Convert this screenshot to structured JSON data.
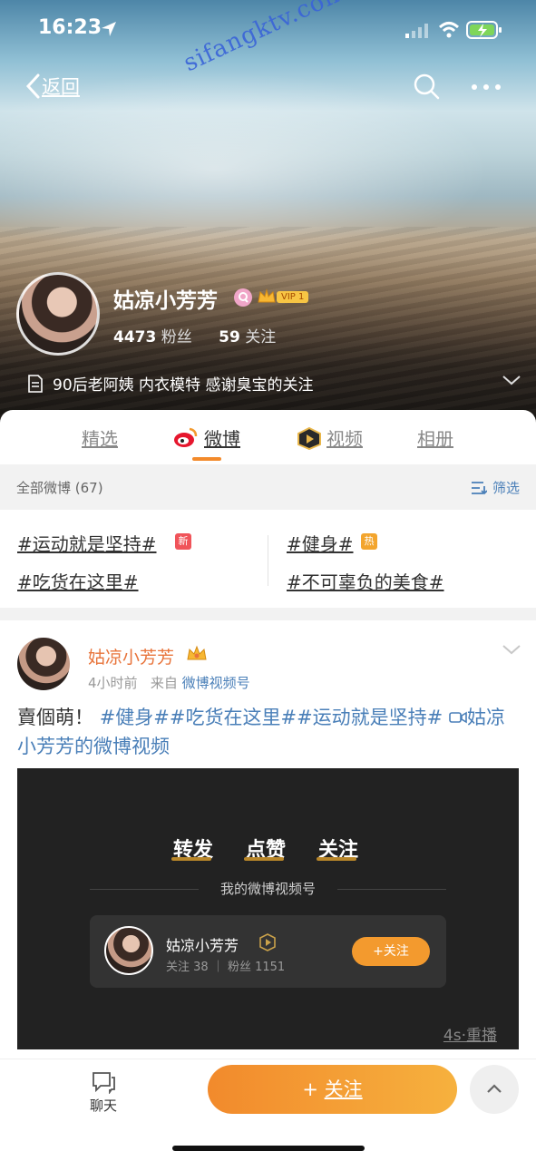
{
  "status_bar": {
    "time": "16:23"
  },
  "watermark": "sifangktv.com",
  "header": {
    "back_label": "返回",
    "username": "姑凉小芳芳",
    "vip_label": "VIP 1",
    "fans_count": "4473",
    "fans_label": "粉丝",
    "follow_count": "59",
    "follow_label": "关注",
    "bio": "90后老阿姨 内衣模特 感谢臭宝的关注"
  },
  "tabs": [
    {
      "label": "精选"
    },
    {
      "label": "微博"
    },
    {
      "label": "视频"
    },
    {
      "label": "相册"
    }
  ],
  "filter_bar": {
    "all_label": "全部微博 (67)",
    "filter_label": "筛选"
  },
  "topics": {
    "left": [
      "#运动就是坚持#",
      "#吃货在这里#"
    ],
    "right": [
      "#健身#",
      "#不可辜负的美食#"
    ],
    "badges": {
      "new": "新",
      "hot": "热"
    }
  },
  "post": {
    "author": "姑凉小芳芳",
    "time": "4小时前",
    "from_prefix": "来自",
    "source": "微博视频号",
    "text_plain": "賣個萌！",
    "text_tags": "#健身##吃货在这里##运动就是坚持#",
    "text_link": "姑凉小芳芳的微博视频"
  },
  "video": {
    "word1": "转发",
    "word2": "点赞",
    "word3": "关注",
    "subtitle": "我的微博视频号",
    "card_name": "姑凉小芳芳",
    "card_stats": "关注 38 ｜ 粉丝 1151",
    "card_button": "+关注",
    "replay": "4s·重播"
  },
  "bottom": {
    "chat_label": "聊天",
    "follow_label": "关注",
    "follow_plus": "+"
  },
  "colors": {
    "accent_orange": "#f28a2c",
    "link_blue": "#4a7fb8",
    "name_orange": "#e8743b"
  }
}
